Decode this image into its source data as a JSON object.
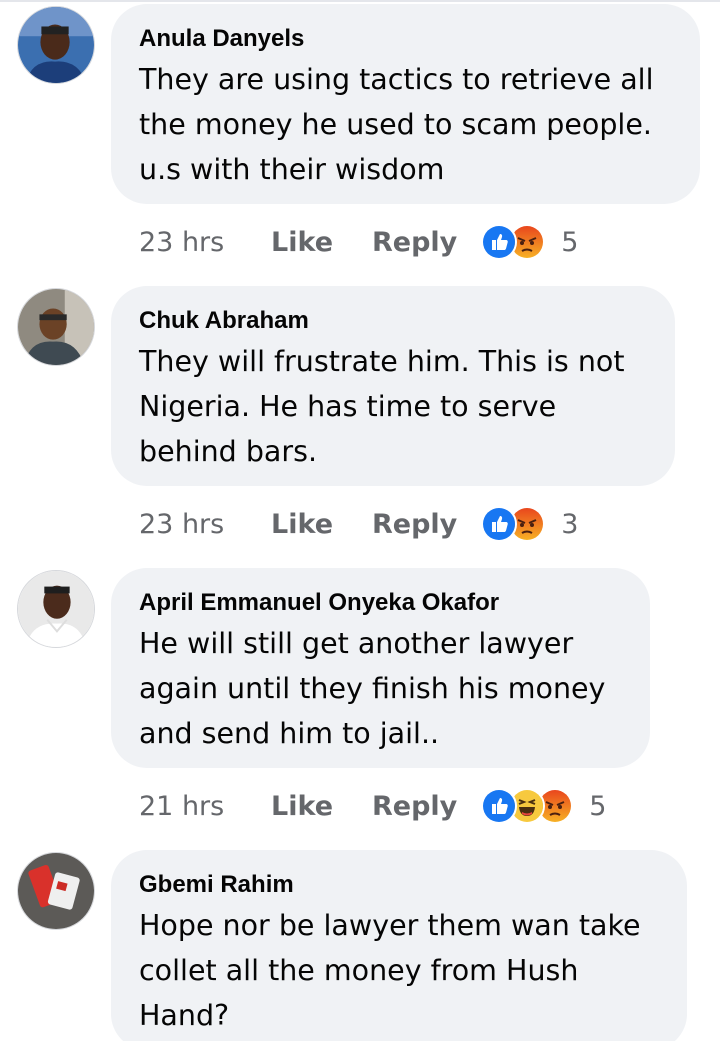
{
  "comments": [
    {
      "author": "Anula Danyels",
      "lines": [
        "They are using tactics to retrieve all",
        "the money he used to scam people.",
        "u.s with their wisdom"
      ],
      "time": "23 hrs",
      "like": "Like",
      "reply": "Reply",
      "reactions": [
        "like-icon",
        "angry-icon"
      ],
      "reaction_count": "5"
    },
    {
      "author": "Chuk Abraham",
      "lines": [
        "They will frustrate him. This is not",
        "Nigeria. He has time to serve",
        "behind bars."
      ],
      "time": "23 hrs",
      "like": "Like",
      "reply": "Reply",
      "reactions": [
        "like-icon",
        "angry-icon"
      ],
      "reaction_count": "3"
    },
    {
      "author": "April Emmanuel Onyeka Okafor",
      "lines": [
        "He will still get another lawyer",
        "again until they finish his money",
        "and send him to jail.."
      ],
      "time": "21 hrs",
      "like": "Like",
      "reply": "Reply",
      "reactions": [
        "like-icon",
        "haha-icon",
        "angry-icon"
      ],
      "reaction_count": "5"
    },
    {
      "author": "Gbemi Rahim",
      "lines": [
        "Hope nor be lawyer them wan take",
        "collet all the money from Hush",
        "Hand?"
      ]
    }
  ],
  "colors": {
    "bubble": "#f0f2f5",
    "text": "#050505",
    "meta": "#65676b",
    "like_blue": "#1877f2",
    "angry_orange": "#f05a22"
  }
}
